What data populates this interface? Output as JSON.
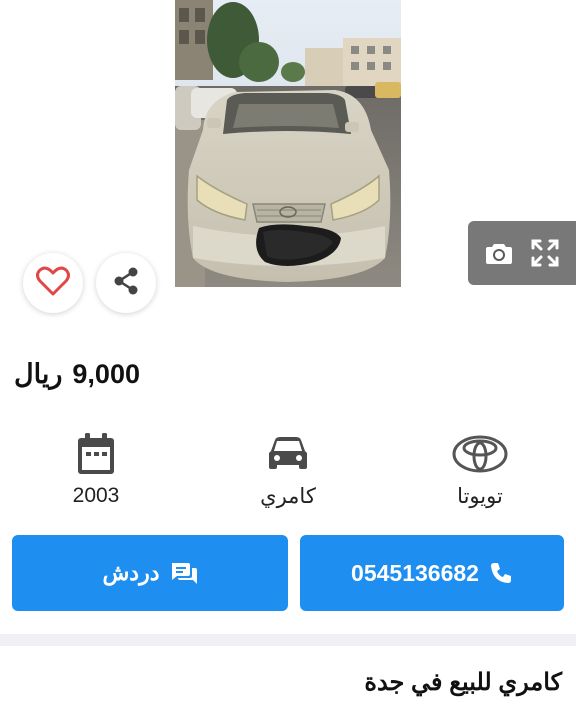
{
  "listing": {
    "price_amount": "9,000",
    "price_currency": "ريال",
    "title": "كامري للبيع في جدة"
  },
  "specs": {
    "year": "2003",
    "model": "كامري",
    "make": "تويوتا"
  },
  "actions": {
    "phone": "0545136682",
    "chat_label": "دردش"
  },
  "icons": {
    "favorite": "heart-icon",
    "share": "share-icon",
    "camera": "camera-icon",
    "expand": "fullscreen-icon",
    "year": "calendar-icon",
    "model": "car-icon",
    "make": "toyota-logo-icon",
    "phone": "phone-icon",
    "chat": "chat-icon"
  },
  "colors": {
    "accent": "#1e8ef0",
    "heart": "#e04848"
  }
}
